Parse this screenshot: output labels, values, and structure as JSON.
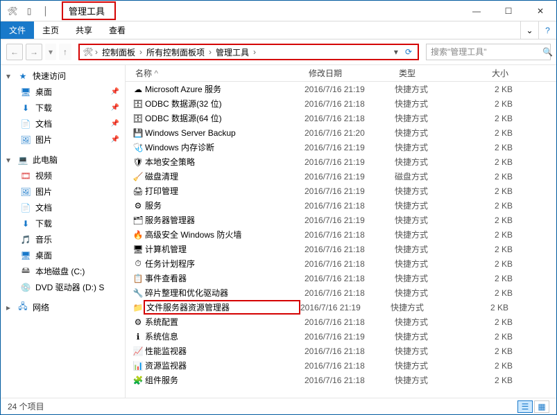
{
  "window": {
    "title": "管理工具"
  },
  "menu": {
    "file": "文件",
    "home": "主页",
    "share": "共享",
    "view": "查看"
  },
  "breadcrumb": {
    "root": "控制面板",
    "mid": "所有控制面板项",
    "leaf": "管理工具"
  },
  "search": {
    "placeholder": "搜索\"管理工具\""
  },
  "columns": {
    "name": "名称",
    "date": "修改日期",
    "type": "类型",
    "size": "大小"
  },
  "sidebar": {
    "quick": "快速访问",
    "desktop": "桌面",
    "downloads": "下载",
    "documents": "文档",
    "pictures": "图片",
    "thispc": "此电脑",
    "videos": "视频",
    "pictures2": "图片",
    "documents2": "文档",
    "downloads2": "下载",
    "music": "音乐",
    "desktop2": "桌面",
    "cdrive": "本地磁盘 (C:)",
    "dvd": "DVD 驱动器 (D:) S",
    "network": "网络"
  },
  "files": [
    {
      "icon": "☁",
      "name": "Microsoft Azure 服务",
      "date": "2016/7/16 21:19",
      "type": "快捷方式",
      "size": "2 KB",
      "hl": false
    },
    {
      "icon": "🗄",
      "name": "ODBC 数据源(32 位)",
      "date": "2016/7/16 21:18",
      "type": "快捷方式",
      "size": "2 KB",
      "hl": false
    },
    {
      "icon": "🗄",
      "name": "ODBC 数据源(64 位)",
      "date": "2016/7/16 21:18",
      "type": "快捷方式",
      "size": "2 KB",
      "hl": false
    },
    {
      "icon": "💾",
      "name": "Windows Server Backup",
      "date": "2016/7/16 21:20",
      "type": "快捷方式",
      "size": "2 KB",
      "hl": false
    },
    {
      "icon": "🩺",
      "name": "Windows 内存诊断",
      "date": "2016/7/16 21:19",
      "type": "快捷方式",
      "size": "2 KB",
      "hl": false
    },
    {
      "icon": "🛡",
      "name": "本地安全策略",
      "date": "2016/7/16 21:19",
      "type": "快捷方式",
      "size": "2 KB",
      "hl": false
    },
    {
      "icon": "🧹",
      "name": "磁盘清理",
      "date": "2016/7/16 21:19",
      "type": "磁盘方式",
      "size": "2 KB",
      "hl": false
    },
    {
      "icon": "🖨",
      "name": "打印管理",
      "date": "2016/7/16 21:19",
      "type": "快捷方式",
      "size": "2 KB",
      "hl": false
    },
    {
      "icon": "⚙",
      "name": "服务",
      "date": "2016/7/16 21:18",
      "type": "快捷方式",
      "size": "2 KB",
      "hl": false
    },
    {
      "icon": "🗂",
      "name": "服务器管理器",
      "date": "2016/7/16 21:19",
      "type": "快捷方式",
      "size": "2 KB",
      "hl": false
    },
    {
      "icon": "🔥",
      "name": "高级安全 Windows 防火墙",
      "date": "2016/7/16 21:18",
      "type": "快捷方式",
      "size": "2 KB",
      "hl": false
    },
    {
      "icon": "🖥",
      "name": "计算机管理",
      "date": "2016/7/16 21:18",
      "type": "快捷方式",
      "size": "2 KB",
      "hl": false
    },
    {
      "icon": "⏱",
      "name": "任务计划程序",
      "date": "2016/7/16 21:18",
      "type": "快捷方式",
      "size": "2 KB",
      "hl": false
    },
    {
      "icon": "📋",
      "name": "事件查看器",
      "date": "2016/7/16 21:18",
      "type": "快捷方式",
      "size": "2 KB",
      "hl": false
    },
    {
      "icon": "🔧",
      "name": "碎片整理和优化驱动器",
      "date": "2016/7/16 21:18",
      "type": "快捷方式",
      "size": "2 KB",
      "hl": false
    },
    {
      "icon": "📁",
      "name": "文件服务器资源管理器",
      "date": "2016/7/16 21:19",
      "type": "快捷方式",
      "size": "2 KB",
      "hl": true
    },
    {
      "icon": "⚙",
      "name": "系统配置",
      "date": "2016/7/16 21:18",
      "type": "快捷方式",
      "size": "2 KB",
      "hl": false
    },
    {
      "icon": "ℹ",
      "name": "系统信息",
      "date": "2016/7/16 21:19",
      "type": "快捷方式",
      "size": "2 KB",
      "hl": false
    },
    {
      "icon": "📈",
      "name": "性能监视器",
      "date": "2016/7/16 21:18",
      "type": "快捷方式",
      "size": "2 KB",
      "hl": false
    },
    {
      "icon": "📊",
      "name": "资源监视器",
      "date": "2016/7/16 21:18",
      "type": "快捷方式",
      "size": "2 KB",
      "hl": false
    },
    {
      "icon": "🧩",
      "name": "组件服务",
      "date": "2016/7/16 21:18",
      "type": "快捷方式",
      "size": "2 KB",
      "hl": false
    }
  ],
  "status": {
    "count": "24 个项目"
  }
}
